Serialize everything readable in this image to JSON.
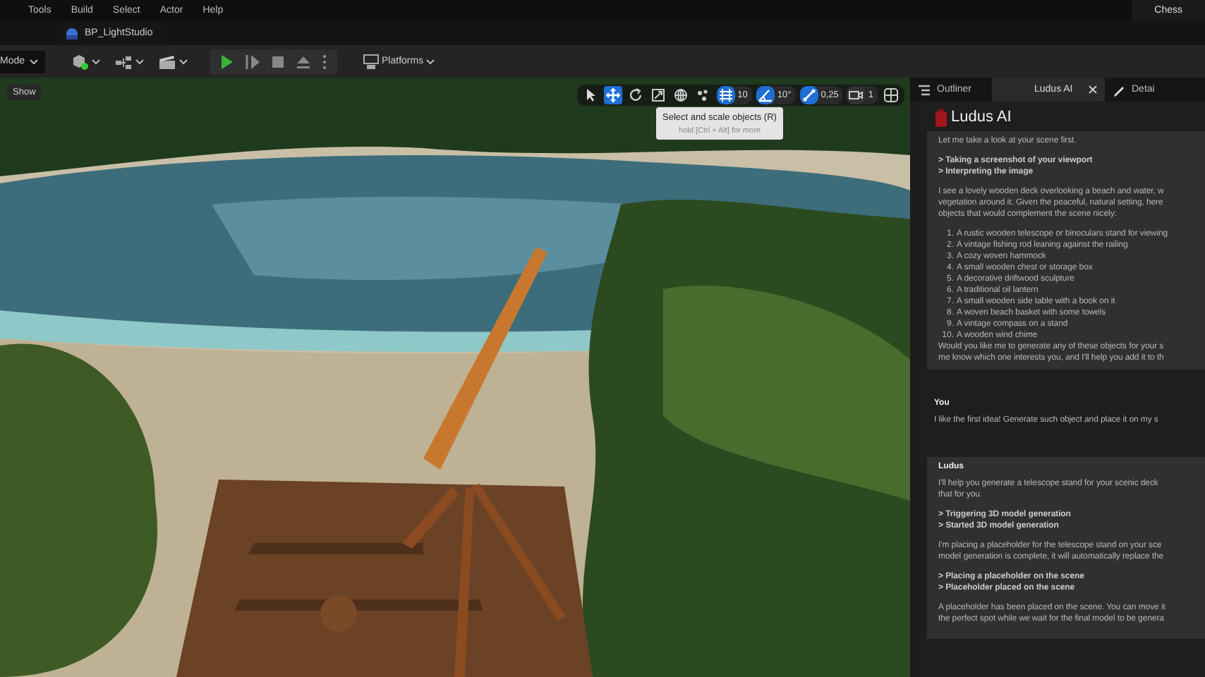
{
  "menu": [
    "Tools",
    "Build",
    "Select",
    "Actor",
    "Help"
  ],
  "workspace_label": "Chess",
  "document_tab": {
    "label": "BP_LightStudio"
  },
  "toolbar": {
    "mode": "Mode",
    "platforms": "Platforms"
  },
  "viewport": {
    "show_button": "Show",
    "tools": [
      {
        "kind": "select",
        "selected": false
      },
      {
        "kind": "move",
        "selected": true
      },
      {
        "kind": "rotate",
        "selected": false
      },
      {
        "kind": "scale",
        "selected": false
      },
      {
        "kind": "globe",
        "selected": false
      },
      {
        "kind": "surface",
        "selected": false
      }
    ],
    "snaps": [
      {
        "kind": "grid",
        "value": "10",
        "on": true
      },
      {
        "kind": "angle",
        "value": "10°",
        "on": true
      },
      {
        "kind": "scale",
        "value": "0,25",
        "on": true
      },
      {
        "kind": "camera",
        "value": "1",
        "on": false
      }
    ],
    "tooltip": {
      "title": "Select and scale objects (R)",
      "hint": "hold [Ctrl + Alt] for more"
    }
  },
  "panel_tabs": [
    {
      "kind": "outliner",
      "label": "Outliner",
      "selected": false
    },
    {
      "kind": "ludus",
      "label": "Ludus AI",
      "selected": true
    },
    {
      "kind": "details",
      "label": "Detai",
      "selected": false
    }
  ],
  "chat": {
    "title": "Ludus AI",
    "messages": [
      {
        "blocks": [
          {
            "kind": "text",
            "lines": [
              "Let me take a look at your scene first."
            ]
          },
          {
            "kind": "steps",
            "lines": [
              "> Taking a screenshot of your viewport",
              "> Interpreting the image"
            ]
          },
          {
            "kind": "text",
            "lines": [
              "I see a lovely wooden deck overlooking a beach and water, w",
              "vegetation around it. Given the peaceful, natural setting, here",
              "objects that would complement the scene nicely:"
            ]
          },
          {
            "kind": "list",
            "items": [
              {
                "number": "1.",
                "text": "A rustic wooden telescope or binoculars stand for viewing"
              },
              {
                "number": "2.",
                "text": "A vintage fishing rod leaning against the railing"
              },
              {
                "number": "3.",
                "text": "A cozy woven hammock"
              },
              {
                "number": "4.",
                "text": "A small wooden chest or storage box"
              },
              {
                "number": "5.",
                "text": "A decorative driftwood sculpture"
              },
              {
                "number": "6.",
                "text": "A traditional oil lantern"
              },
              {
                "number": "7.",
                "text": "A small wooden side table with a book on it"
              },
              {
                "number": "8.",
                "text": "A woven beach basket with some towels"
              },
              {
                "number": "9.",
                "text": "A vintage compass on a stand"
              },
              {
                "number": "10.",
                "text": "A wooden wind chime"
              }
            ]
          },
          {
            "kind": "tight",
            "lines": [
              "Would you like me to generate any of these objects for your s",
              "me know which one interests you, and I'll help you add it to th"
            ]
          }
        ]
      },
      {
        "author": "You",
        "boxed": false,
        "blocks": [
          {
            "kind": "text",
            "lines": [
              "I like the first idea! Generate such object and place it on my s"
            ]
          }
        ]
      },
      {
        "author": "Ludus",
        "boxed": true,
        "blocks": [
          {
            "kind": "text",
            "lines": [
              "I'll help you generate a telescope stand for your scenic deck",
              "that for you."
            ]
          },
          {
            "kind": "steps",
            "lines": [
              "> Triggering 3D model generation",
              "> Started 3D model generation"
            ]
          },
          {
            "kind": "text",
            "lines": [
              "I'm placing a placeholder for the telescope stand on your sce",
              "model generation is complete, it will automatically replace the"
            ]
          },
          {
            "kind": "steps",
            "lines": [
              "> Placing a placeholder on the scene",
              "> Placeholder placed on the scene"
            ]
          },
          {
            "kind": "text",
            "lines": [
              "A placeholder has been placed on the scene. You can move it",
              "the perfect spot while we wait for the final model to be genera"
            ]
          }
        ]
      }
    ]
  }
}
